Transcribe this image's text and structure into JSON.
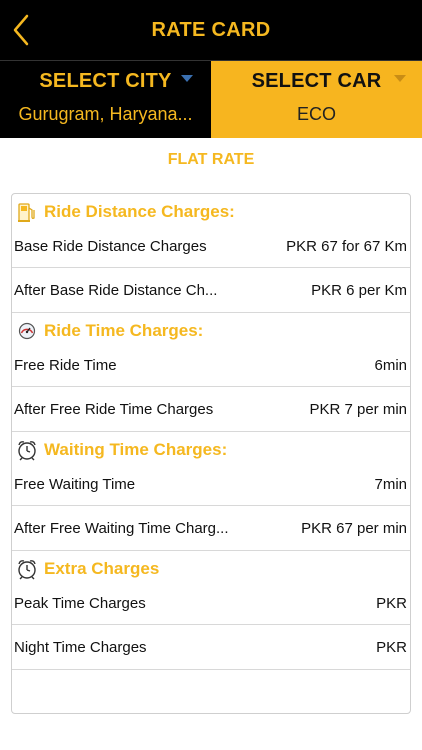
{
  "header": {
    "title": "RATE CARD",
    "back_icon": "chevron-left-icon"
  },
  "selectors": {
    "city": {
      "label": "SELECT CITY",
      "value": "Gurugram, Haryana..."
    },
    "car": {
      "label": "SELECT CAR",
      "value": "ECO"
    }
  },
  "flat_rate_label": "FLAT RATE",
  "colors": {
    "accent": "#f5b820",
    "header_bg": "#000000",
    "car_bg": "#f7b51f"
  },
  "sections": [
    {
      "title": "Ride Distance Charges:",
      "icon": "fuel-pump-icon",
      "rows": [
        {
          "label": "Base Ride Distance Charges",
          "value": "PKR 67 for 67 Km"
        },
        {
          "label": "After Base Ride Distance Ch...",
          "value": "PKR 6 per Km"
        }
      ]
    },
    {
      "title": "Ride Time Charges:",
      "icon": "speedometer-icon",
      "rows": [
        {
          "label": "Free Ride Time",
          "value": "6min"
        },
        {
          "label": "After Free Ride Time Charges",
          "value": "PKR 7 per min"
        }
      ]
    },
    {
      "title": "Waiting Time Charges:",
      "icon": "alarm-clock-icon",
      "rows": [
        {
          "label": "Free Waiting Time",
          "value": "7min"
        },
        {
          "label": "After Free Waiting Time Charg...",
          "value": "PKR 67 per min"
        }
      ]
    },
    {
      "title": "Extra Charges",
      "icon": "alarm-clock-icon",
      "rows": [
        {
          "label": "Peak Time Charges",
          "value": "PKR"
        },
        {
          "label": "Night Time Charges",
          "value": "PKR"
        }
      ]
    }
  ]
}
